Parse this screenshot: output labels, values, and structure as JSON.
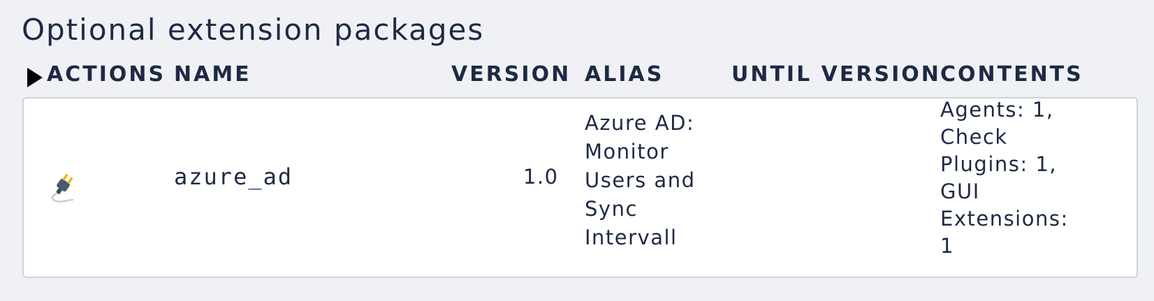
{
  "section": {
    "title": "Optional extension packages"
  },
  "table": {
    "headers": {
      "actions": "ACTIONS",
      "name": "NAME",
      "version": "VERSION",
      "alias": "ALIAS",
      "until_version": "UNTIL VERSION",
      "contents": "CONTENTS"
    },
    "rows": [
      {
        "action_icon": "plug-icon",
        "name": "azure_ad",
        "version": "1.0",
        "alias_lines": [
          "Azure AD:",
          "Monitor",
          "Users and",
          "Sync",
          "Intervall"
        ],
        "until_version": "",
        "contents_lines": [
          "Agents: 1,",
          "Check",
          "Plugins: 1,",
          "GUI",
          "Extensions:",
          "1"
        ]
      }
    ]
  }
}
